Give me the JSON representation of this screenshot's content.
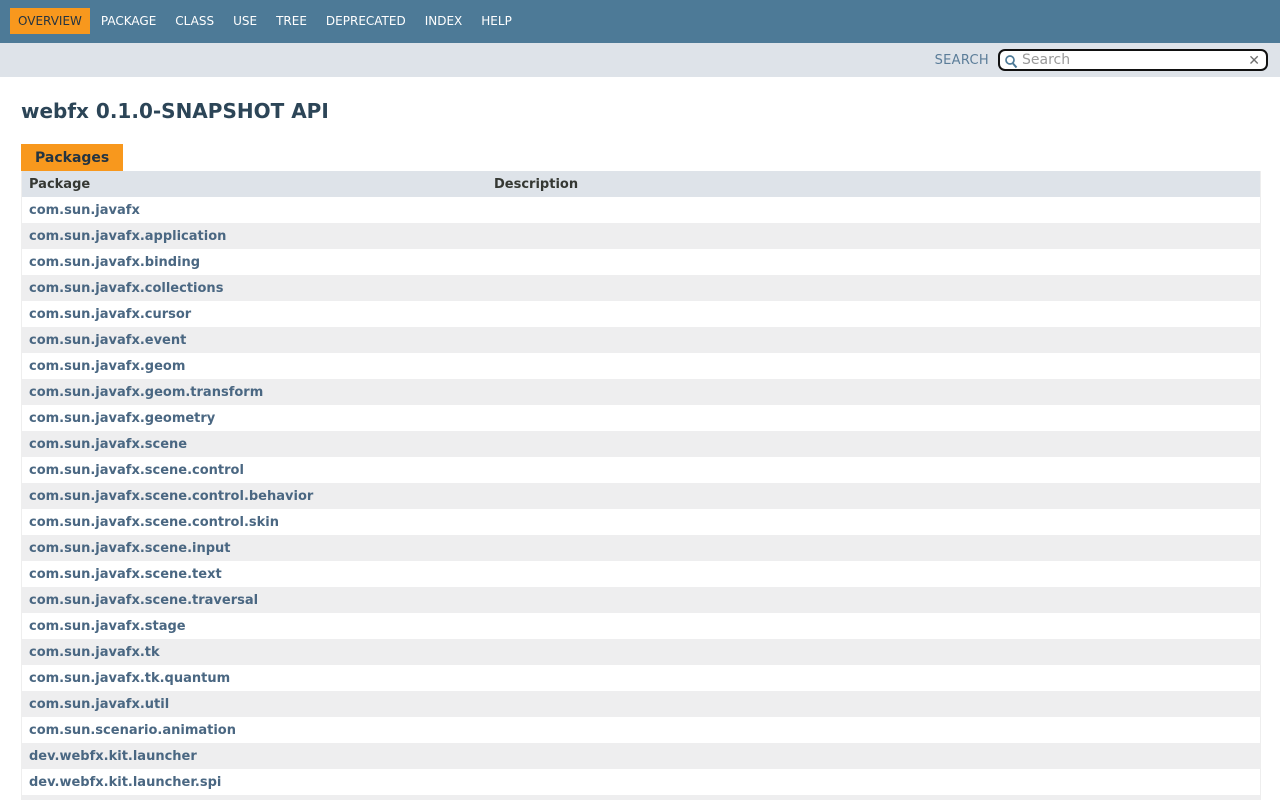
{
  "nav": {
    "items": [
      {
        "label": "OVERVIEW",
        "active": true
      },
      {
        "label": "PACKAGE",
        "active": false
      },
      {
        "label": "CLASS",
        "active": false
      },
      {
        "label": "USE",
        "active": false
      },
      {
        "label": "TREE",
        "active": false
      },
      {
        "label": "DEPRECATED",
        "active": false
      },
      {
        "label": "INDEX",
        "active": false
      },
      {
        "label": "HELP",
        "active": false
      }
    ]
  },
  "search": {
    "label": "SEARCH",
    "placeholder": "Search",
    "value": "",
    "reset_glyph": "✕",
    "icon": "magnifier-icon"
  },
  "page": {
    "title": "webfx 0.1.0-SNAPSHOT API"
  },
  "packages_table": {
    "tab_label": "Packages",
    "columns": [
      "Package",
      "Description"
    ],
    "rows": [
      {
        "package": "com.sun.javafx",
        "description": ""
      },
      {
        "package": "com.sun.javafx.application",
        "description": ""
      },
      {
        "package": "com.sun.javafx.binding",
        "description": ""
      },
      {
        "package": "com.sun.javafx.collections",
        "description": ""
      },
      {
        "package": "com.sun.javafx.cursor",
        "description": ""
      },
      {
        "package": "com.sun.javafx.event",
        "description": ""
      },
      {
        "package": "com.sun.javafx.geom",
        "description": ""
      },
      {
        "package": "com.sun.javafx.geom.transform",
        "description": ""
      },
      {
        "package": "com.sun.javafx.geometry",
        "description": ""
      },
      {
        "package": "com.sun.javafx.scene",
        "description": ""
      },
      {
        "package": "com.sun.javafx.scene.control",
        "description": ""
      },
      {
        "package": "com.sun.javafx.scene.control.behavior",
        "description": ""
      },
      {
        "package": "com.sun.javafx.scene.control.skin",
        "description": ""
      },
      {
        "package": "com.sun.javafx.scene.input",
        "description": ""
      },
      {
        "package": "com.sun.javafx.scene.text",
        "description": ""
      },
      {
        "package": "com.sun.javafx.scene.traversal",
        "description": ""
      },
      {
        "package": "com.sun.javafx.stage",
        "description": ""
      },
      {
        "package": "com.sun.javafx.tk",
        "description": ""
      },
      {
        "package": "com.sun.javafx.tk.quantum",
        "description": ""
      },
      {
        "package": "com.sun.javafx.util",
        "description": ""
      },
      {
        "package": "com.sun.scenario.animation",
        "description": ""
      },
      {
        "package": "dev.webfx.kit.launcher",
        "description": ""
      },
      {
        "package": "dev.webfx.kit.launcher.spi",
        "description": ""
      }
    ],
    "partial_next_row_visible": true
  },
  "colors": {
    "nav_background": "#4D7A97",
    "active_tab_background": "#F8981D",
    "active_tab_text": "#253441",
    "subnav_background": "#DEE3E9",
    "link": "#4A6782",
    "title": "#2C4557",
    "table_header_background": "#DEE3E9",
    "alt_row_background": "#EEEEEF"
  }
}
